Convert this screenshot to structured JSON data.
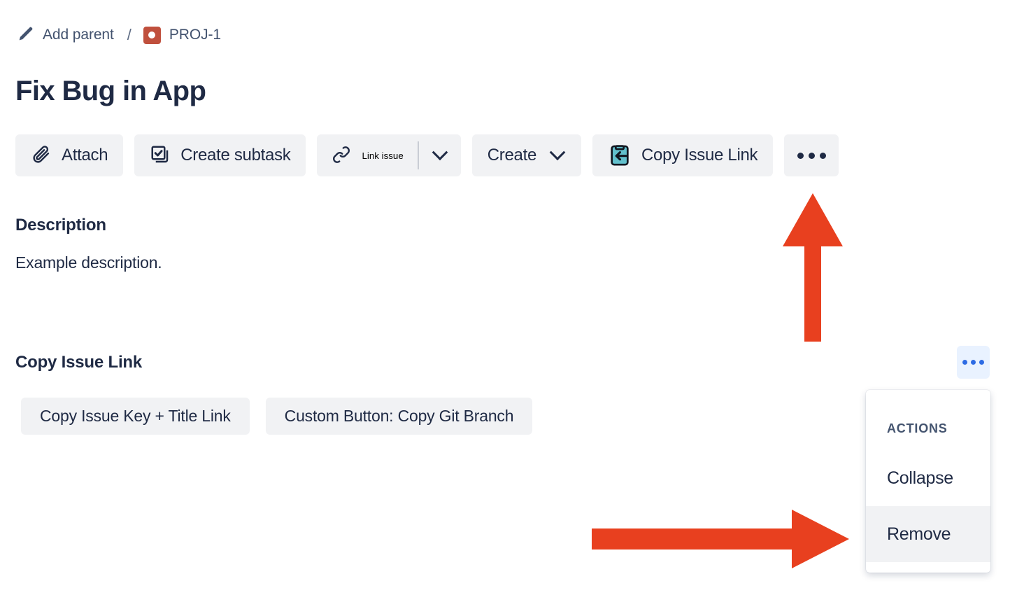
{
  "breadcrumb": {
    "add_parent_label": "Add parent",
    "pencil_icon": "pencil-icon",
    "separator": "/",
    "issue_key": "PROJ-1",
    "issue_type_icon": "bug-issue-type-icon"
  },
  "page_title": "Fix Bug in App",
  "toolbar": {
    "attach_label": "Attach",
    "create_subtask_label": "Create subtask",
    "link_issue_label": "Link issue",
    "create_label": "Create",
    "copy_issue_link_label": "Copy Issue Link",
    "more_label": "•••"
  },
  "description": {
    "heading": "Description",
    "body": "Example description."
  },
  "copy_issue_link_section": {
    "heading": "Copy Issue Link",
    "buttons": [
      {
        "label": "Copy Issue Key + Title Link"
      },
      {
        "label": "Custom Button: Copy Git Branch"
      }
    ]
  },
  "dropdown": {
    "group_title": "ACTIONS",
    "items": [
      {
        "label": "Collapse",
        "highlighted": false
      },
      {
        "label": "Remove",
        "highlighted": true
      }
    ]
  },
  "annotations": {
    "arrow_color": "#E8401F",
    "up_arrow": "points-to-copy-issue-link-button",
    "right_arrow": "points-to-remove-menu-item"
  },
  "colors": {
    "text_primary": "#1F2A44",
    "text_muted": "#42526E",
    "button_bg": "#F1F2F4",
    "accent_blue": "#2D6BE4",
    "accent_blue_bg": "#E9F2FF",
    "issue_type_red": "#C0503D",
    "clipboard_teal": "#62C0CC",
    "page_bg": "#FFFFFF"
  }
}
